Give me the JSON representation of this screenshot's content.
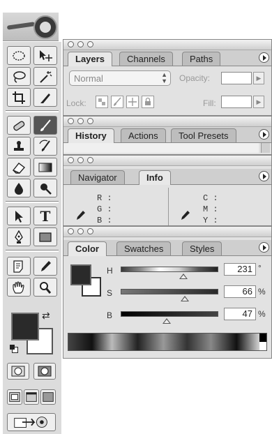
{
  "layers_panel": {
    "tabs": [
      "Layers",
      "Channels",
      "Paths"
    ],
    "blend_mode": "Normal",
    "opacity_label": "Opacity:",
    "opacity_value": "",
    "lock_label": "Lock:",
    "fill_label": "Fill:",
    "fill_value": ""
  },
  "history_panel": {
    "tabs": [
      "History",
      "Actions",
      "Tool Presets"
    ]
  },
  "navigator_panel": {
    "tabs": [
      "Navigator",
      "Info"
    ],
    "rgb_labels": [
      "R :",
      "G :",
      "B :"
    ],
    "cmy_labels": [
      "C :",
      "M :",
      "Y :"
    ]
  },
  "color_panel": {
    "tabs": [
      "Color",
      "Swatches",
      "Styles"
    ],
    "h_label": "H",
    "s_label": "S",
    "b_label": "B",
    "h_value": "231",
    "s_value": "66",
    "b_value": "47",
    "h_unit": "°",
    "s_unit": "%",
    "b_unit": "%",
    "h_fraction": 0.64,
    "s_fraction": 0.66,
    "b_fraction": 0.47,
    "fg_color": "#2a2a2a",
    "bg_color": "#ffffff"
  },
  "toolbox": {
    "type_tool_glyph": "T"
  }
}
